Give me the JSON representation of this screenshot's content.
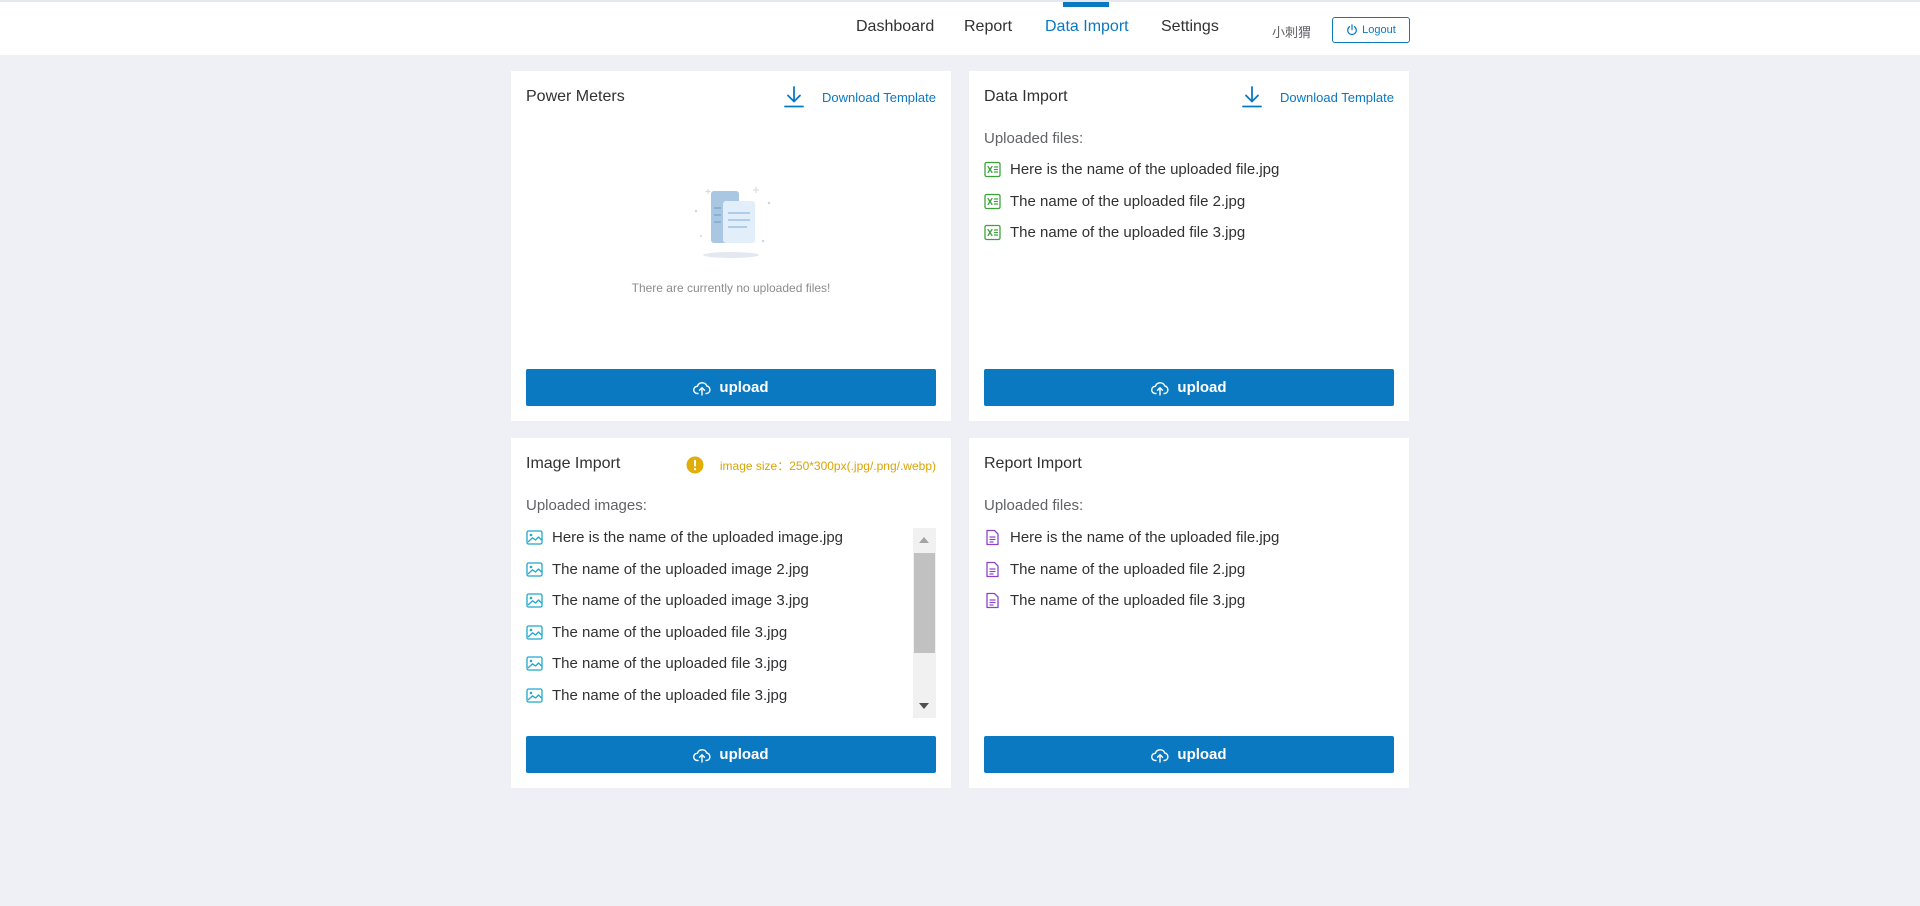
{
  "nav": {
    "items": [
      {
        "label": "Dashboard"
      },
      {
        "label": "Report"
      },
      {
        "label": "Data Import"
      },
      {
        "label": "Settings"
      }
    ],
    "active": "Data Import",
    "user_name": "小刺猬",
    "logout_label": "Logout"
  },
  "colors": {
    "accent": "#0b78c2",
    "background": "#eef0f5",
    "warning": "#d9a406",
    "data_file_icon": "#3aa33a",
    "image_file_icon": "#1fa9c9",
    "report_file_icon": "#8a44c9"
  },
  "cards": {
    "power_meters": {
      "title": "Power Meters",
      "download_label": "Download Template",
      "empty_text": "There are currently no uploaded files!",
      "upload_label": "upload"
    },
    "data_import": {
      "title": "Data Import",
      "download_label": "Download Template",
      "files_label": "Uploaded files:",
      "files": [
        "Here is the name of the uploaded file.jpg",
        "The name of the uploaded file 2.jpg",
        "The name of the uploaded file 3.jpg"
      ],
      "upload_label": "upload"
    },
    "image_import": {
      "title": "Image Import",
      "hint": "image size：250*300px(.jpg/.png/.webp)",
      "files_label": "Uploaded images:",
      "files": [
        "Here is the name of the uploaded image.jpg",
        "The name of the uploaded image 2.jpg",
        "The name of the uploaded image 3.jpg",
        "The name of the uploaded file 3.jpg",
        "The name of the uploaded file 3.jpg",
        "The name of the uploaded file 3.jpg"
      ],
      "upload_label": "upload"
    },
    "report_import": {
      "title": "Report Import",
      "files_label": "Uploaded files:",
      "files": [
        "Here is the name of the uploaded file.jpg",
        "The name of the uploaded file 2.jpg",
        "The name of the uploaded file 3.jpg"
      ],
      "upload_label": "upload"
    }
  },
  "icons": {
    "download": "download-icon",
    "upload": "cloud-upload-icon",
    "logout": "power-icon",
    "warning": "exclamation-circle-icon",
    "data_file": "excel-file-icon",
    "image_file": "image-file-icon",
    "report_file": "document-file-icon",
    "empty": "empty-folder-illustration"
  }
}
